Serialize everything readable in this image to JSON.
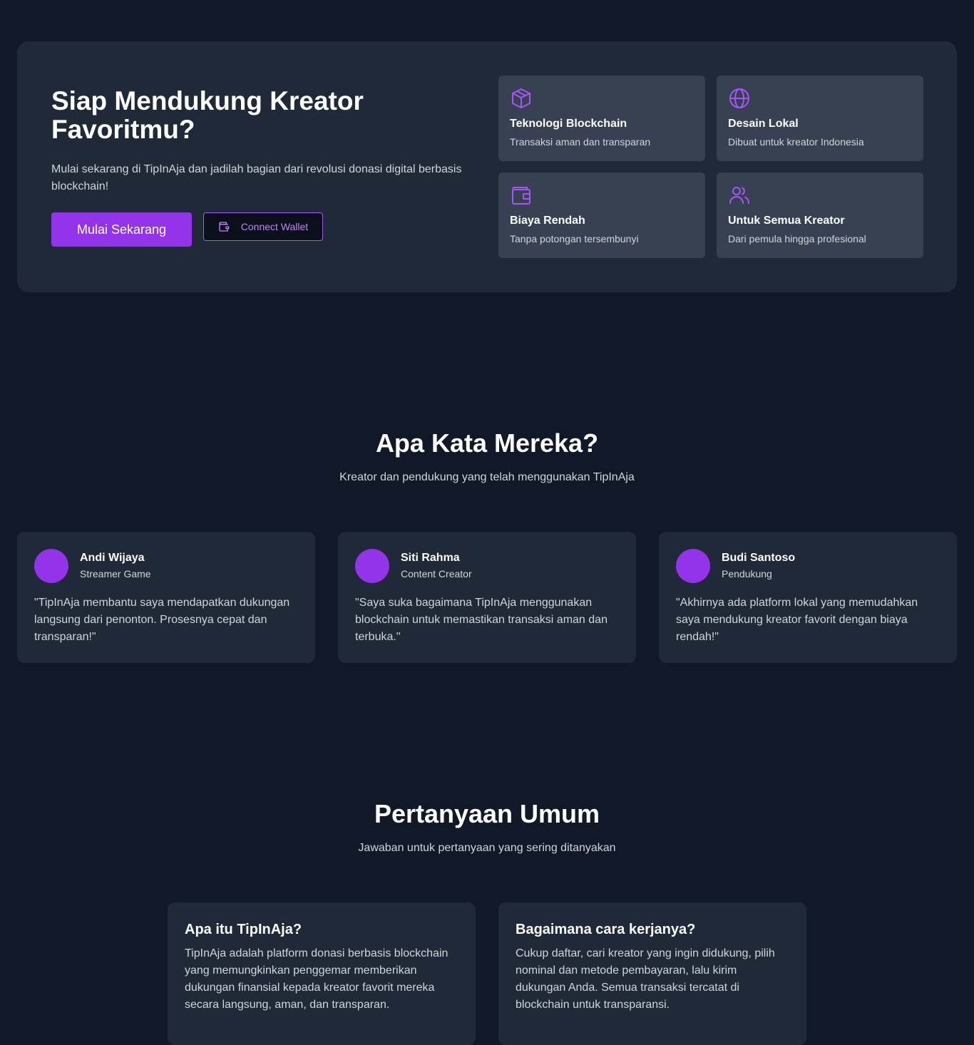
{
  "cta": {
    "title": "Siap Mendukung Kreator Favoritmu?",
    "description": "Mulai sekarang di TipInAja dan jadilah bagian dari revolusi donasi digital berbasis blockchain!",
    "primary_label": "Mulai Sekarang",
    "wallet_label": "Connect Wallet",
    "features": [
      {
        "icon": "cube-icon",
        "title": "Teknologi Blockchain",
        "subtitle": "Transaksi aman dan transparan"
      },
      {
        "icon": "globe-icon",
        "title": "Desain Lokal",
        "subtitle": "Dibuat untuk kreator Indonesia"
      },
      {
        "icon": "wallet-icon",
        "title": "Biaya Rendah",
        "subtitle": "Tanpa potongan tersembunyi"
      },
      {
        "icon": "users-icon",
        "title": "Untuk Semua Kreator",
        "subtitle": "Dari pemula hingga profesional"
      }
    ]
  },
  "testimonials": {
    "title": "Apa Kata Mereka?",
    "subtitle": "Kreator dan pendukung yang telah menggunakan TipInAja",
    "items": [
      {
        "name": "Andi Wijaya",
        "role": "Streamer Game",
        "quote": "\"TipInAja membantu saya mendapatkan dukungan langsung dari penonton. Prosesnya cepat dan transparan!\""
      },
      {
        "name": "Siti Rahma",
        "role": "Content Creator",
        "quote": "\"Saya suka bagaimana TipInAja menggunakan blockchain untuk memastikan transaksi aman dan terbuka.\""
      },
      {
        "name": "Budi Santoso",
        "role": "Pendukung",
        "quote": "\"Akhirnya ada platform lokal yang memudahkan saya mendukung kreator favorit dengan biaya rendah!\""
      }
    ]
  },
  "faq": {
    "title": "Pertanyaan Umum",
    "subtitle": "Jawaban untuk pertanyaan yang sering ditanyakan",
    "items": [
      {
        "question": "Apa itu TipInAja?",
        "answer": "TipInAja adalah platform donasi berbasis blockchain yang memungkinkan penggemar memberikan dukungan finansial kepada kreator favorit mereka secara langsung, aman, dan transparan."
      },
      {
        "question": "Bagaimana cara kerjanya?",
        "answer": "Cukup daftar, cari kreator yang ingin didukung, pilih nominal dan metode pembayaran, lalu kirim dukungan Anda. Semua transaksi tercatat di blockchain untuk transparansi."
      }
    ]
  },
  "colors": {
    "background": "#111827",
    "card": "#1f2937",
    "feature_card": "#374151",
    "accent": "#9333ea",
    "accent_light": "#c084fc"
  }
}
